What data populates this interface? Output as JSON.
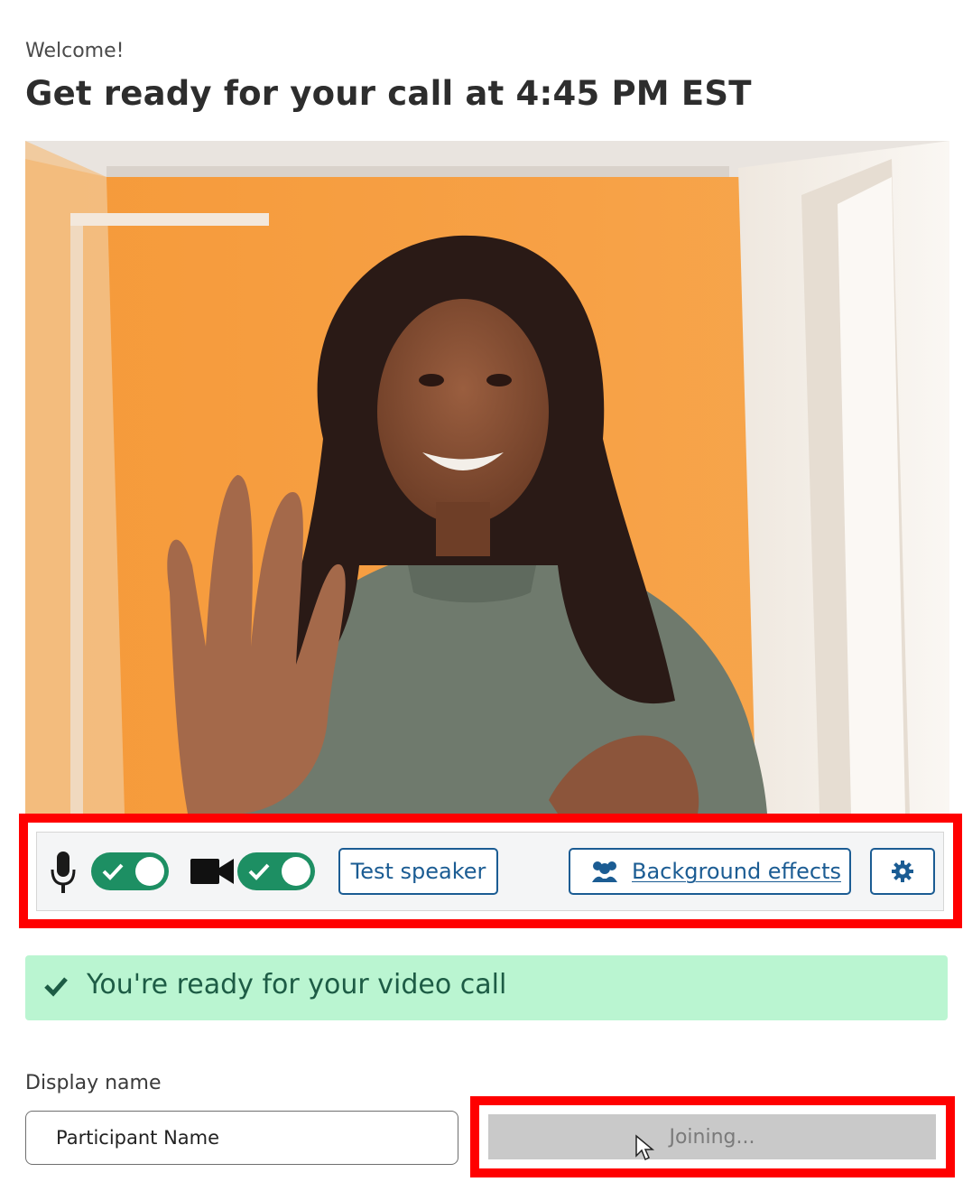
{
  "welcome": "Welcome!",
  "title": "Get ready for your call at 4:45 PM EST",
  "video": {
    "alt": "Self-view camera preview"
  },
  "toolbar": {
    "mic_icon": "microphone-icon",
    "camera_icon": "video-camera-icon",
    "mic_enabled": true,
    "camera_enabled": true,
    "test_speaker_label": "Test speaker",
    "background_effects_label": "Background effects",
    "background_icon": "people-icon",
    "settings_icon": "gear-icon"
  },
  "status": {
    "text": "You're ready for your video call",
    "icon": "checkmark-icon"
  },
  "display_name": {
    "label": "Display name",
    "value": "Participant Name"
  },
  "join_button": {
    "label": "Joining..."
  },
  "colors": {
    "accent": "#1b5c93",
    "toggle_on": "#1d8f63",
    "ready_bg": "#baf5d1",
    "highlight": "#ff0000"
  }
}
